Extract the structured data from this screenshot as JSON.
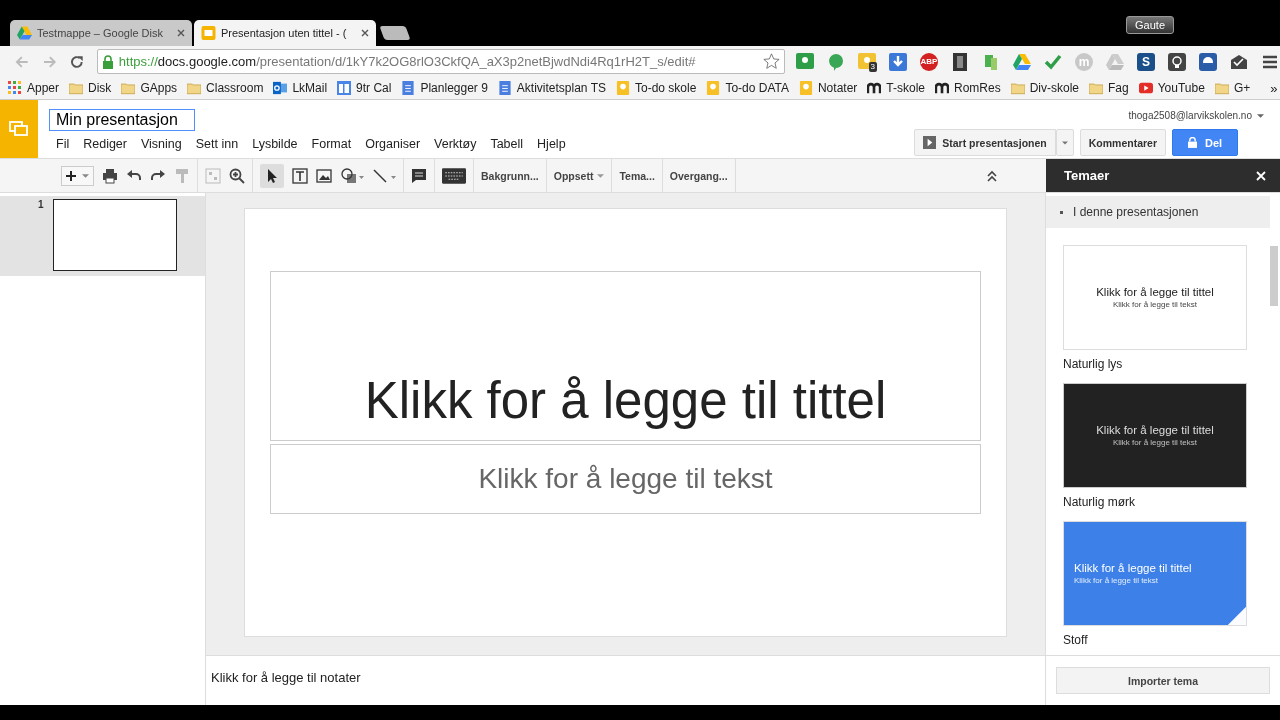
{
  "browser": {
    "tabs": [
      {
        "title": "Testmappe – Google Disk",
        "kind": "drive",
        "selected": false
      },
      {
        "title": "Presentasjon uten tittel - (",
        "kind": "slides",
        "selected": true
      }
    ],
    "profile": "Gaute",
    "url": {
      "scheme": "https://",
      "host": "docs.google.com",
      "path": "/presentation/d/1kY7k2OG8rlO3CkfQA_aX3p2netBjwdNdi4Rq1rH2T_s/edit#"
    },
    "extensions": [
      {
        "kind": "board"
      },
      {
        "kind": "bubble"
      },
      {
        "kind": "chat",
        "badge": "3"
      },
      {
        "kind": "download"
      },
      {
        "kind": "stop",
        "label": "ABP"
      },
      {
        "kind": "film"
      },
      {
        "kind": "puzzle"
      },
      {
        "kind": "drive"
      },
      {
        "kind": "check"
      },
      {
        "kind": "coin",
        "label": "m"
      },
      {
        "kind": "drivegrey"
      },
      {
        "kind": "tile",
        "label": "S"
      },
      {
        "kind": "bulb"
      },
      {
        "kind": "swirl"
      },
      {
        "kind": "mail"
      },
      {
        "kind": "menu"
      }
    ],
    "bookmarks": [
      {
        "label": "Apper",
        "kind": "apps"
      },
      {
        "label": "Disk",
        "kind": "folder"
      },
      {
        "label": "GApps",
        "kind": "folder"
      },
      {
        "label": "Classroom",
        "kind": "folder"
      },
      {
        "label": "LkMail",
        "kind": "outlook"
      },
      {
        "label": "9tr Cal",
        "kind": "calendar"
      },
      {
        "label": "Planlegger 9",
        "kind": "doc"
      },
      {
        "label": "Aktivitetsplan TS",
        "kind": "doc"
      },
      {
        "label": "To-do skole",
        "kind": "keep"
      },
      {
        "label": "To-do DATA",
        "kind": "keep"
      },
      {
        "label": "Notater",
        "kind": "keep"
      },
      {
        "label": "T-skole",
        "kind": "moodle"
      },
      {
        "label": "RomRes",
        "kind": "moodle"
      },
      {
        "label": "Div-skole",
        "kind": "folder"
      },
      {
        "label": "Fag",
        "kind": "folder"
      },
      {
        "label": "YouTube",
        "kind": "youtube"
      },
      {
        "label": "G+",
        "kind": "folder"
      }
    ],
    "more_bookmarks": "»"
  },
  "app": {
    "title": "Min presentasjon",
    "menu": [
      "Fil",
      "Rediger",
      "Visning",
      "Sett inn",
      "Lysbilde",
      "Format",
      "Organiser",
      "Verktøy",
      "Tabell",
      "Hjelp"
    ],
    "account": "thoga2508@larvikskolen.no",
    "buttons": {
      "present": "Start presentasjonen",
      "comment": "Kommentarer",
      "share": "Del"
    },
    "toolbar_buttons": [
      {
        "label": "Bakgrunn...",
        "dropdown": false
      },
      {
        "label": "Oppsett",
        "dropdown": true
      },
      {
        "label": "Tema...",
        "dropdown": false
      },
      {
        "label": "Overgang...",
        "dropdown": false
      }
    ],
    "slides": [
      {
        "number": "1",
        "selected": true
      }
    ],
    "slide": {
      "title_placeholder": "Klikk for å legge til tittel",
      "subtitle_placeholder": "Klikk for å legge til tekst"
    },
    "notes_placeholder": "Klikk for å legge til notater",
    "themes_panel": {
      "title": "Temaer",
      "section": "I denne presentasjonen",
      "import_button": "Importer tema",
      "themes": [
        {
          "name": "Naturlig lys",
          "kind": "light",
          "title": "Klikk for å legge til tittel",
          "subtitle": "Klikk for å legge til tekst"
        },
        {
          "name": "Naturlig mørk",
          "kind": "dark",
          "title": "Klikk for å legge til tittel",
          "subtitle": "Klikk for å legge til tekst"
        },
        {
          "name": "Stoff",
          "kind": "blue",
          "title": "Klikk for å legge til tittel",
          "subtitle": "Klikk for å legge til tekst"
        }
      ]
    }
  }
}
